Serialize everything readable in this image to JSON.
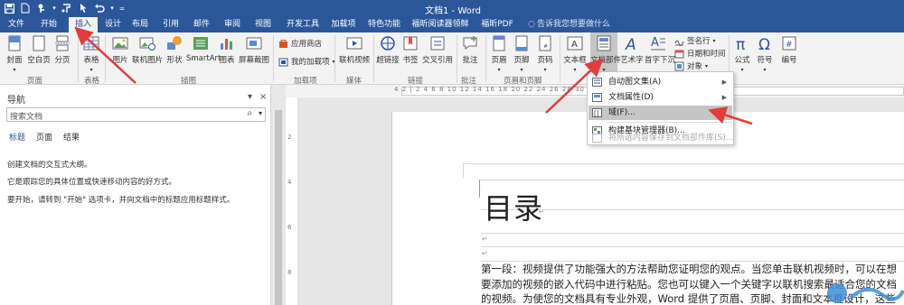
{
  "window": {
    "title": "文档1 - Word"
  },
  "tabs": [
    "文件",
    "开始",
    "插入",
    "设计",
    "布局",
    "引用",
    "邮件",
    "审阅",
    "视图",
    "开发工具",
    "加载项",
    "特色功能",
    "福昕阅读器领鲜版",
    "福昕PDF"
  ],
  "tell_me": "告诉我您想要做什么",
  "ribbon": {
    "pages": {
      "cover": "封面",
      "blank": "空白页",
      "break": "分页",
      "group": "页面"
    },
    "tables": {
      "table": "表格",
      "group": "表格"
    },
    "illustrations": {
      "pictures": "图片",
      "online_pictures": "联机图片",
      "shapes": "形状",
      "smartart": "SmartArt",
      "chart": "图表",
      "screenshot": "屏幕截图",
      "group": "插图"
    },
    "addins": {
      "store": "应用商店",
      "my_addins": "我的加载项",
      "group": "加载项"
    },
    "media": {
      "online_video": "联机视频",
      "group": "媒体"
    },
    "links": {
      "hyperlink": "超链接",
      "bookmark": "书签",
      "cross_ref": "交叉引用",
      "group": "链接"
    },
    "comments": {
      "comment": "批注",
      "group": "批注"
    },
    "header_footer": {
      "header": "页眉",
      "footer": "页脚",
      "page_number": "页码",
      "group": "页眉和页脚"
    },
    "text": {
      "textbox": "文本框",
      "quick_parts": "文档部件",
      "wordart": "艺术字",
      "dropcap": "首字下沉",
      "signature": "签名行",
      "datetime": "日期和时间",
      "object": "对象"
    },
    "symbols": {
      "equation": "公式",
      "symbol": "符号",
      "number": "编号"
    }
  },
  "quick_parts_menu": {
    "items": [
      {
        "label": "自动图文集(A)",
        "submenu": true,
        "disabled": false
      },
      {
        "label": "文档属性(D)",
        "submenu": true,
        "disabled": false
      },
      {
        "label": "域(F)...",
        "submenu": false,
        "disabled": false
      },
      {
        "label": "构建基块管理器(B)...",
        "submenu": false,
        "disabled": false
      },
      {
        "label": "将所选内容保存到文档部件库(S)...",
        "submenu": false,
        "disabled": true
      }
    ]
  },
  "nav_pane": {
    "title": "导航",
    "search_placeholder": "搜索文档",
    "tabs": [
      "标题",
      "页面",
      "结果"
    ],
    "lines": [
      "创建文档的交互式大纲。",
      "它是跟踪您的具体位置或快速移动内容的好方式。",
      "要开始，请转到 \"开始\" 选项卡，并向文档中的标题应用标题样式。"
    ]
  },
  "ruler": {
    "horizontal": "4  2  |  2  4  6  8  10  12  14  16  18  20  22  24  26  28  30  32  34  36  38  40  42",
    "vertical": [
      "2",
      "4",
      "6",
      "8"
    ]
  },
  "document": {
    "heading": "目录",
    "para_lines": [
      "第一段：视频提供了功能强大的方法帮助您证明您的观点。当您单击联机视频时，可以在想",
      "要添加的视频的嵌入代码中进行粘贴。您也可以键入一个关键字以联机搜索最适合您的文档",
      "的视频。为使您的文档具有专业外观，Word 提供了页眉、页脚、封面和文本框设计，这些"
    ]
  },
  "colors": {
    "brand": "#2b579a",
    "ribbon_bg": "#f3f3f3",
    "arrow": "#e23c3c"
  }
}
